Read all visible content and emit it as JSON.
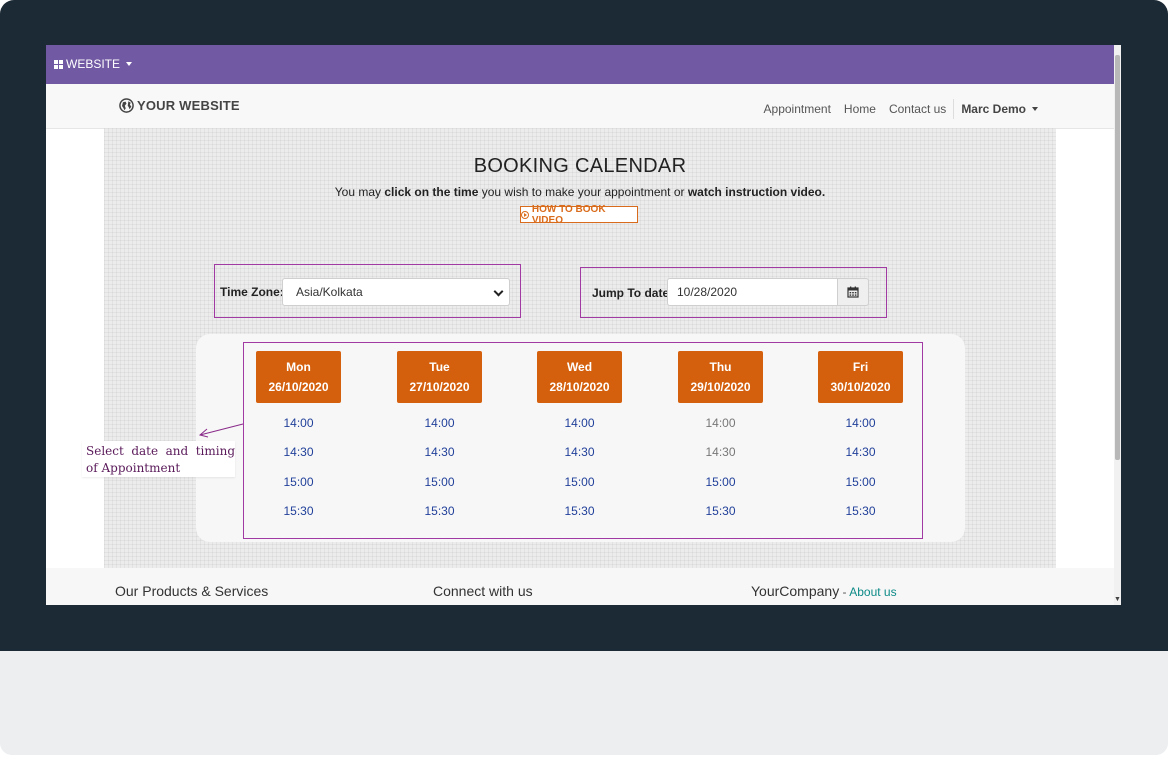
{
  "topbar": {
    "website_menu": "WEBSITE"
  },
  "navbar": {
    "logo": "YOUR WEBSITE",
    "links": [
      "Appointment",
      "Home",
      "Contact us"
    ],
    "user": "Marc Demo"
  },
  "booking": {
    "title": "BOOKING CALENDAR",
    "subtitle": {
      "part1": "You may ",
      "bold1": "click on the time",
      "part2": " you wish to make your appointment or ",
      "bold2": "watch instruction video."
    },
    "video_button": "HOW TO BOOK VIDEO",
    "timezone_label": "Time Zone:",
    "timezone_value": "Asia/Kolkata",
    "jump_label": "Jump To date:",
    "jump_value": "10/28/2020",
    "days": [
      {
        "day": "Mon",
        "date": "26/10/2020",
        "slots": [
          {
            "time": "14:00",
            "available": true
          },
          {
            "time": "14:30",
            "available": true
          },
          {
            "time": "15:00",
            "available": true
          },
          {
            "time": "15:30",
            "available": true
          }
        ]
      },
      {
        "day": "Tue",
        "date": "27/10/2020",
        "slots": [
          {
            "time": "14:00",
            "available": true
          },
          {
            "time": "14:30",
            "available": true
          },
          {
            "time": "15:00",
            "available": true
          },
          {
            "time": "15:30",
            "available": true
          }
        ]
      },
      {
        "day": "Wed",
        "date": "28/10/2020",
        "slots": [
          {
            "time": "14:00",
            "available": true
          },
          {
            "time": "14:30",
            "available": true
          },
          {
            "time": "15:00",
            "available": true
          },
          {
            "time": "15:30",
            "available": true
          }
        ]
      },
      {
        "day": "Thu",
        "date": "29/10/2020",
        "slots": [
          {
            "time": "14:00",
            "available": false
          },
          {
            "time": "14:30",
            "available": false
          },
          {
            "time": "15:00",
            "available": true
          },
          {
            "time": "15:30",
            "available": true
          }
        ]
      },
      {
        "day": "Fri",
        "date": "30/10/2020",
        "slots": [
          {
            "time": "14:00",
            "available": true
          },
          {
            "time": "14:30",
            "available": true
          },
          {
            "time": "15:00",
            "available": true
          },
          {
            "time": "15:30",
            "available": true
          }
        ]
      }
    ]
  },
  "annotation": "Select date and timing of Appointment",
  "footer": {
    "col1": "Our Products & Services",
    "col2": "Connect with us",
    "col3_title": "YourCompany",
    "col3_sep": " - ",
    "col3_link": "About us"
  },
  "colors": {
    "topbar": "#7159a3",
    "day_header": "#d4600d",
    "highlight_border": "#a23aa3",
    "slot_available": "#21409a",
    "slot_unavailable": "#777777",
    "footer_link": "#0c8a87"
  }
}
